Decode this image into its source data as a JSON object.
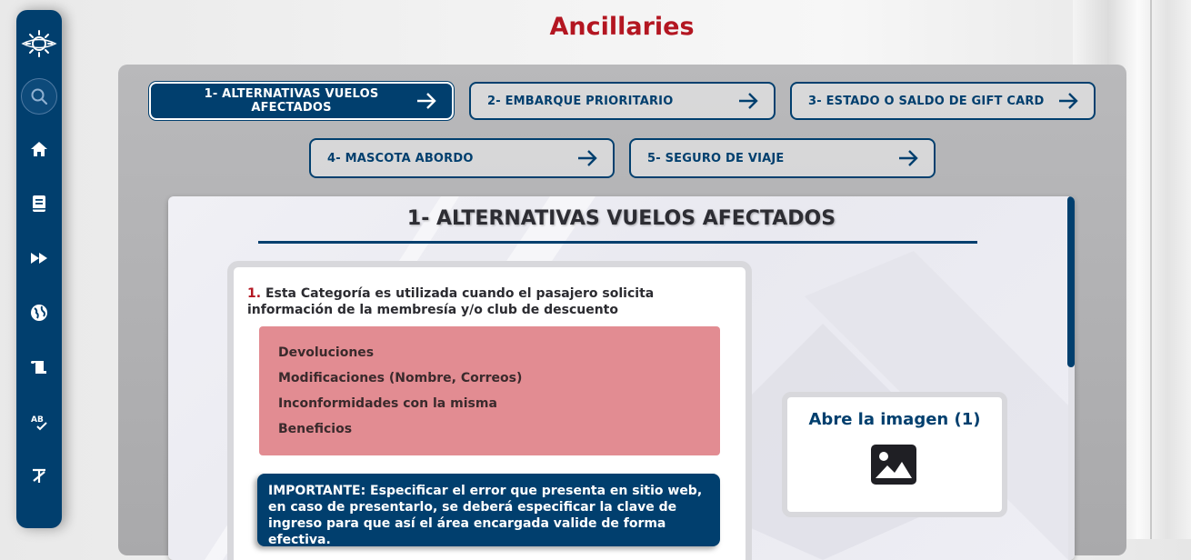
{
  "page": {
    "title": "Ancillaries"
  },
  "sidebar": {
    "items": [
      {
        "name": "logo",
        "icon": "sun-logo-icon"
      },
      {
        "name": "search",
        "icon": "search-icon"
      },
      {
        "name": "home",
        "icon": "home-icon"
      },
      {
        "name": "book",
        "icon": "book-icon"
      },
      {
        "name": "fast-forward",
        "icon": "fast-forward-icon"
      },
      {
        "name": "globe",
        "icon": "globe-icon"
      },
      {
        "name": "scroll",
        "icon": "scroll-icon"
      },
      {
        "name": "spellcheck",
        "icon": "spellcheck-icon"
      },
      {
        "name": "text-format",
        "icon": "clear-format-icon"
      }
    ]
  },
  "tabs": [
    {
      "label": "1- ALTERNATIVAS VUELOS AFECTADOS",
      "active": true
    },
    {
      "label": "2- EMBARQUE PRIORITARIO",
      "active": false
    },
    {
      "label": "3- ESTADO O SALDO DE GIFT CARD",
      "active": false
    },
    {
      "label": "4- MASCOTA ABORDO",
      "active": false
    },
    {
      "label": "5- SEGURO DE VIAJE",
      "active": false
    }
  ],
  "section": {
    "title": "1- ALTERNATIVAS VUELOS AFECTADOS",
    "item_number": "1.",
    "description": "Esta Categoría es utilizada cuando el pasajero solicita información de la membresía y/o club de descuento",
    "list": [
      "Devoluciones",
      "Modificaciones (Nombre, Correos)",
      "Inconformidades con la misma",
      "Beneficios"
    ],
    "important_label": "IMPORTANTE:",
    "important_text": " Especificar el error que presenta en sitio web, en caso de presentarlo, se deberá especificar la clave de ingreso para que así el área encargada valide de forma efectiva.",
    "image_card_label": "Abre la imagen (1)"
  },
  "colors": {
    "accent": "#013f6e",
    "title_red": "#b31621",
    "pink": "#e28c92"
  }
}
